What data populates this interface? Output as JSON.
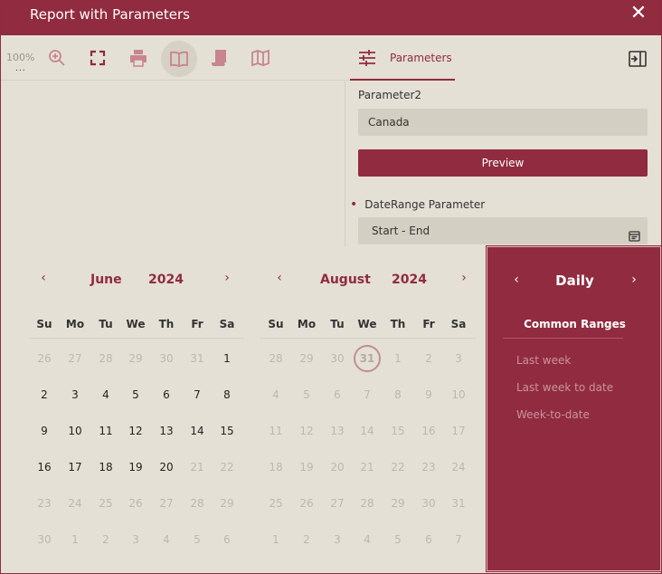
{
  "window": {
    "title": "Report with Parameters"
  },
  "toolbar": {
    "zoom": "100%",
    "zoom_dots": "..."
  },
  "params_header": {
    "tab_label": "Parameters"
  },
  "parameters": {
    "param2_label": "Parameter2",
    "param2_value": "Canada",
    "preview_label": "Preview",
    "daterange_label": "DateRange Parameter",
    "daterange_value": "Start - End"
  },
  "calendars": [
    {
      "month": "June",
      "year": "2024",
      "dow": [
        "Su",
        "Mo",
        "Tu",
        "We",
        "Th",
        "Fr",
        "Sa"
      ],
      "weeks": [
        [
          {
            "d": "26",
            "m": true
          },
          {
            "d": "27",
            "m": true
          },
          {
            "d": "28",
            "m": true
          },
          {
            "d": "29",
            "m": true
          },
          {
            "d": "30",
            "m": true
          },
          {
            "d": "31",
            "m": true
          },
          {
            "d": "1",
            "m": false
          }
        ],
        [
          {
            "d": "2",
            "m": false
          },
          {
            "d": "3",
            "m": false
          },
          {
            "d": "4",
            "m": false
          },
          {
            "d": "5",
            "m": false
          },
          {
            "d": "6",
            "m": false
          },
          {
            "d": "7",
            "m": false
          },
          {
            "d": "8",
            "m": false
          }
        ],
        [
          {
            "d": "9",
            "m": false
          },
          {
            "d": "10",
            "m": false
          },
          {
            "d": "11",
            "m": false
          },
          {
            "d": "12",
            "m": false
          },
          {
            "d": "13",
            "m": false
          },
          {
            "d": "14",
            "m": false
          },
          {
            "d": "15",
            "m": false
          }
        ],
        [
          {
            "d": "16",
            "m": false
          },
          {
            "d": "17",
            "m": false
          },
          {
            "d": "18",
            "m": false
          },
          {
            "d": "19",
            "m": false
          },
          {
            "d": "20",
            "m": false
          },
          {
            "d": "21",
            "m": true
          },
          {
            "d": "22",
            "m": true
          }
        ],
        [
          {
            "d": "23",
            "m": true
          },
          {
            "d": "24",
            "m": true
          },
          {
            "d": "25",
            "m": true
          },
          {
            "d": "26",
            "m": true
          },
          {
            "d": "27",
            "m": true
          },
          {
            "d": "28",
            "m": true
          },
          {
            "d": "29",
            "m": true
          }
        ],
        [
          {
            "d": "30",
            "m": true
          },
          {
            "d": "1",
            "m": true
          },
          {
            "d": "2",
            "m": true
          },
          {
            "d": "3",
            "m": true
          },
          {
            "d": "4",
            "m": true
          },
          {
            "d": "5",
            "m": true
          },
          {
            "d": "6",
            "m": true
          }
        ]
      ]
    },
    {
      "month": "August",
      "year": "2024",
      "dow": [
        "Su",
        "Mo",
        "Tu",
        "We",
        "Th",
        "Fr",
        "Sa"
      ],
      "weeks": [
        [
          {
            "d": "28",
            "m": true
          },
          {
            "d": "29",
            "m": true
          },
          {
            "d": "30",
            "m": true
          },
          {
            "d": "31",
            "m": true,
            "today": true
          },
          {
            "d": "1",
            "m": true
          },
          {
            "d": "2",
            "m": true
          },
          {
            "d": "3",
            "m": true
          }
        ],
        [
          {
            "d": "4",
            "m": true
          },
          {
            "d": "5",
            "m": true
          },
          {
            "d": "6",
            "m": true
          },
          {
            "d": "7",
            "m": true
          },
          {
            "d": "8",
            "m": true
          },
          {
            "d": "9",
            "m": true
          },
          {
            "d": "10",
            "m": true
          }
        ],
        [
          {
            "d": "11",
            "m": true
          },
          {
            "d": "12",
            "m": true
          },
          {
            "d": "13",
            "m": true
          },
          {
            "d": "14",
            "m": true
          },
          {
            "d": "15",
            "m": true
          },
          {
            "d": "16",
            "m": true
          },
          {
            "d": "17",
            "m": true
          }
        ],
        [
          {
            "d": "18",
            "m": true
          },
          {
            "d": "19",
            "m": true
          },
          {
            "d": "20",
            "m": true
          },
          {
            "d": "21",
            "m": true
          },
          {
            "d": "22",
            "m": true
          },
          {
            "d": "23",
            "m": true
          },
          {
            "d": "24",
            "m": true
          }
        ],
        [
          {
            "d": "25",
            "m": true
          },
          {
            "d": "26",
            "m": true
          },
          {
            "d": "27",
            "m": true
          },
          {
            "d": "28",
            "m": true
          },
          {
            "d": "29",
            "m": true
          },
          {
            "d": "30",
            "m": true
          },
          {
            "d": "31",
            "m": true
          }
        ],
        [
          {
            "d": "1",
            "m": true
          },
          {
            "d": "2",
            "m": true
          },
          {
            "d": "3",
            "m": true
          },
          {
            "d": "4",
            "m": true
          },
          {
            "d": "5",
            "m": true
          },
          {
            "d": "6",
            "m": true
          },
          {
            "d": "7",
            "m": true
          }
        ]
      ]
    }
  ],
  "range_panel": {
    "title": "Daily",
    "common_title": "Common Ranges",
    "items": [
      "Last week",
      "Last week to date",
      "Week-to-date"
    ]
  },
  "colors": {
    "accent": "#912b3f",
    "background": "#e4e0d5",
    "input_bg": "#d3cfc2",
    "muted_text": "#bdb8ad"
  },
  "icons": [
    "close-icon",
    "zoom-in-icon",
    "fullscreen-icon",
    "print-icon",
    "book-icon",
    "scroll-icon",
    "map-icon",
    "sliders-icon",
    "panel-toggle-icon",
    "calendar-icon",
    "chevron-left-icon",
    "chevron-right-icon"
  ]
}
